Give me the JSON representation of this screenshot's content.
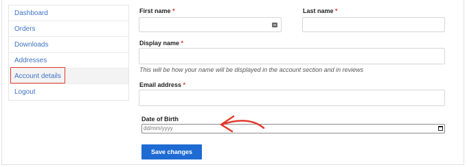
{
  "sidebar": {
    "items": [
      {
        "label": "Dashboard"
      },
      {
        "label": "Orders"
      },
      {
        "label": "Downloads"
      },
      {
        "label": "Addresses"
      },
      {
        "label": "Account details"
      },
      {
        "label": "Logout"
      }
    ]
  },
  "form": {
    "first_name": {
      "label": "First name",
      "required": "*",
      "value": ""
    },
    "last_name": {
      "label": "Last name",
      "required": "*",
      "value": ""
    },
    "display_name": {
      "label": "Display name",
      "required": "*",
      "value": "",
      "help": "This will be how your name will be displayed in the account section and in reviews"
    },
    "email": {
      "label": "Email address",
      "required": "*",
      "value": ""
    },
    "dob": {
      "label": "Date of Birth",
      "placeholder": "dd/mm/yyyy"
    },
    "save_label": "Save changes"
  },
  "colors": {
    "link": "#3f74c4",
    "required": "#d63a2e",
    "button": "#1e6bd3",
    "highlight": "#e2382c"
  },
  "icons": {
    "autofill": "contact-card-icon",
    "calendar": "calendar-icon",
    "annotation": "arrow-annotation-icon"
  }
}
